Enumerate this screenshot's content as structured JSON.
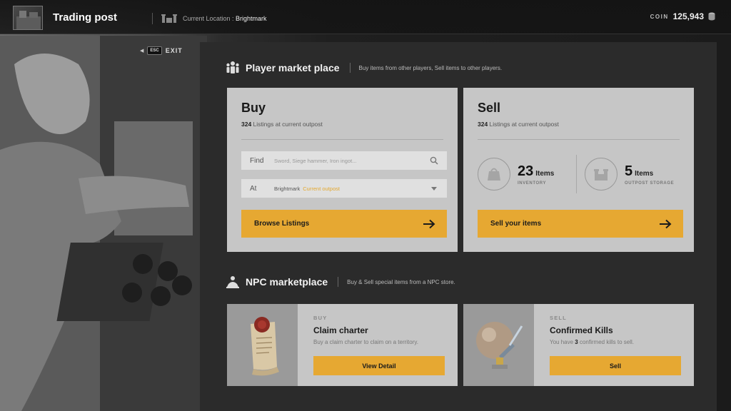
{
  "header": {
    "title": "Trading post",
    "location_prefix": "Current Location : ",
    "location_name": "Brightmark",
    "coin_label": "COIN",
    "coin_value": "125,943"
  },
  "exit": {
    "key": "ESC",
    "label": "EXIT"
  },
  "player_market": {
    "title": "Player market place",
    "description": "Buy items from other players, Sell items to other players.",
    "buy": {
      "title": "Buy",
      "listing_count": "324",
      "listing_suffix": " Listings at current outpost",
      "find_label": "Find",
      "find_placeholder": "Sword, Siege hammer, Iron ingot...",
      "at_label": "At",
      "at_value": "Brightmark",
      "at_badge": "Current outpost",
      "cta": "Browse Listings"
    },
    "sell": {
      "title": "Sell",
      "listing_count": "324",
      "listing_suffix": " Listings at current outpost",
      "inventory_count": "23",
      "inventory_unit": "Items",
      "inventory_caption": "INVENTORY",
      "storage_count": "5",
      "storage_unit": "Items",
      "storage_caption": "OUTPOST STORAGE",
      "cta": "Sell your items"
    }
  },
  "npc_market": {
    "title": "NPC marketplace",
    "description": "Buy & Sell special items from a NPC store.",
    "buy_card": {
      "tag": "BUY",
      "title": "Claim charter",
      "description": "Buy a claim charter to claim on a territory.",
      "button": "View Detail"
    },
    "sell_card": {
      "tag": "SELL",
      "title": "Confirmed Kills",
      "desc_prefix": "You have ",
      "desc_count": "3",
      "desc_suffix": " confirmed kills to sell.",
      "button": "Sell"
    }
  },
  "colors": {
    "accent": "#e6a832",
    "card_bg": "#c6c6c6",
    "panel_bg": "#2b2b2b"
  }
}
